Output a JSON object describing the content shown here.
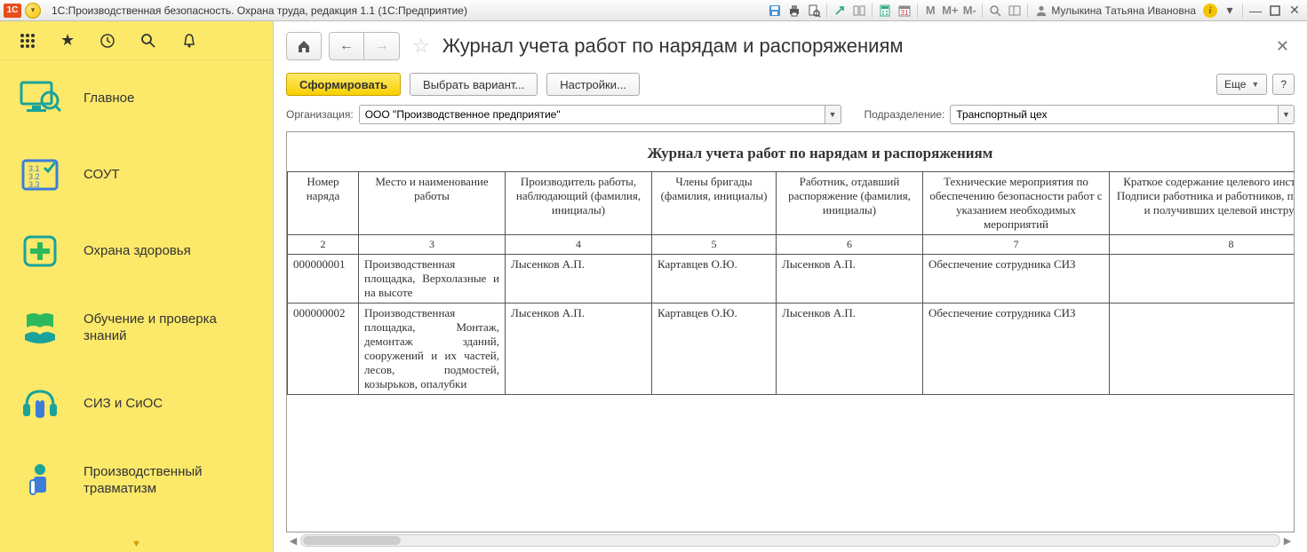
{
  "titlebar": {
    "logo": "1C",
    "title": "1С:Производственная безопасность. Охрана труда, редакция 1.1  (1С:Предприятие)",
    "user": "Мулыкина Татьяна Ивановна"
  },
  "sidebar": {
    "items": [
      {
        "label": "Главное"
      },
      {
        "label": "СОУТ"
      },
      {
        "label": "Охрана здоровья"
      },
      {
        "label": "Обучение и проверка знаний"
      },
      {
        "label": "СИЗ и СиОС"
      },
      {
        "label": "Производственный травматизм"
      }
    ]
  },
  "page": {
    "title": "Журнал учета работ по нарядам и распоряжениям"
  },
  "toolbar": {
    "generate": "Сформировать",
    "chooseVariant": "Выбрать вариант...",
    "settings": "Настройки...",
    "more": "Еще",
    "help": "?"
  },
  "filters": {
    "org_label": "Организация:",
    "org_value": "ООО \"Производственное предприятие\"",
    "dept_label": "Подразделение:",
    "dept_value": "Транспортный цех"
  },
  "report": {
    "title": "Журнал учета работ по нарядам и распоряжениям",
    "headers": [
      "Номер наряда",
      "Место и наименование работы",
      "Производитель работы, наблюдающий (фамилия, инициалы)",
      "Члены бригады (фамилия, инициалы)",
      "Работник, отдавший распоряжение (фамилия, инициалы)",
      "Технические мероприятия по обеспечению безопасности работ с указанием необходимых мероприятий",
      "Краткое содержание целевого инструктажа. Подписи работника и работников, проведшего и получивших целевой инструктаж"
    ],
    "colnums": [
      "2",
      "3",
      "4",
      "5",
      "6",
      "7",
      "8"
    ],
    "rows": [
      {
        "c1": "000000001",
        "c2": "Производственная площадка, Верхолазные и на высоте",
        "c3": "Лысенков А.П.",
        "c4": "Картавцев О.Ю.",
        "c5": "Лысенков А.П.",
        "c6": "Обеспечение сотрудника СИЗ",
        "c7": ""
      },
      {
        "c1": "000000002",
        "c2": "Производственная площадка, Монтаж, демонтаж зданий, сооружений и их частей, лесов, подмостей, козырьков, опалубки",
        "c3": "Лысенков А.П.",
        "c4": "Картавцев О.Ю.",
        "c5": "Лысенков А.П.",
        "c6": "Обеспечение сотрудника СИЗ",
        "c7": ""
      }
    ]
  }
}
